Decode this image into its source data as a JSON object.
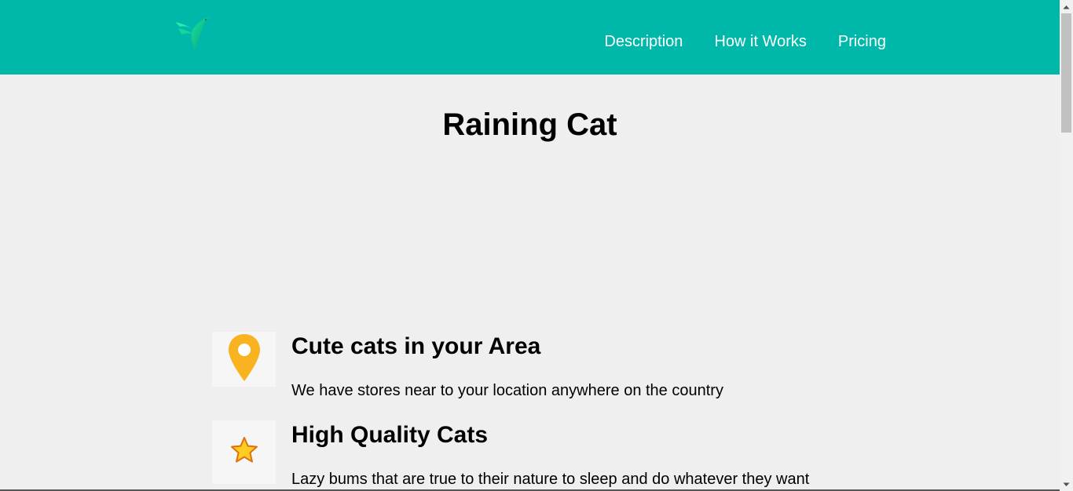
{
  "nav": {
    "logo_icon": "hummingbird-logo",
    "links": [
      {
        "label": "Description"
      },
      {
        "label": "How it Works"
      },
      {
        "label": "Pricing"
      }
    ]
  },
  "hero": {
    "title": "Raining Cat"
  },
  "features": [
    {
      "icon": "location-pin-icon",
      "title": "Cute cats in your Area",
      "text": "We have stores near to your location anywhere on the country"
    },
    {
      "icon": "star-icon",
      "title": "High Quality Cats",
      "text": "Lazy bums that are true to their nature to sleep and do whatever they want"
    }
  ],
  "colors": {
    "navbar": "#00b8aa",
    "background": "#efefef",
    "pin": "#f9b320",
    "star": "#ffcc22"
  }
}
